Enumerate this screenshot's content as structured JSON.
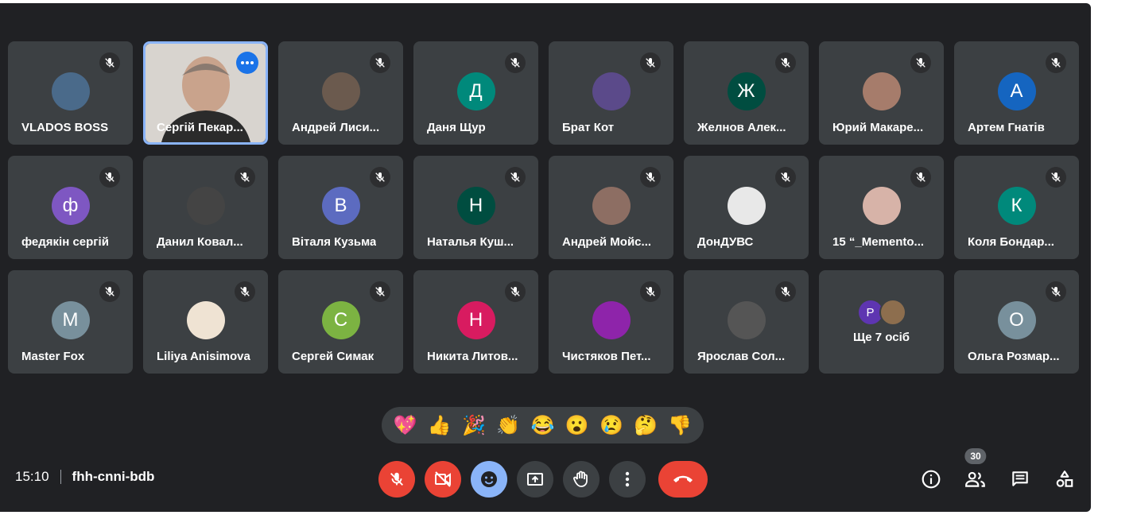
{
  "meeting": {
    "time": "15:10",
    "code": "fhh-cnni-bdb",
    "participant_count": "30"
  },
  "participants": [
    {
      "name": "VLADOS BOSS",
      "avatar_color": "#4a6a8a",
      "avatar_letter": ""
    },
    {
      "name": "Сергій Пекар...",
      "video": true
    },
    {
      "name": "Андрей Лиси...",
      "avatar_color": "#6b5a4e",
      "avatar_letter": ""
    },
    {
      "name": "Даня Щур",
      "avatar_color": "#00897b",
      "avatar_letter": "Д"
    },
    {
      "name": "Брат Кот",
      "avatar_color": "#5b4a8a",
      "avatar_letter": ""
    },
    {
      "name": "Желнов Алек...",
      "avatar_color": "#004d40",
      "avatar_letter": "Ж"
    },
    {
      "name": "Юрий Макаре...",
      "avatar_color": "#a67c6b",
      "avatar_letter": ""
    },
    {
      "name": "Артем Гнатів",
      "avatar_color": "#1565c0",
      "avatar_letter": "А"
    },
    {
      "name": "федякін сергій",
      "avatar_color": "#7e57c2",
      "avatar_letter": "ф"
    },
    {
      "name": "Данил Ковал...",
      "avatar_color": "#444444",
      "avatar_letter": ""
    },
    {
      "name": "Віталя Кузьма",
      "avatar_color": "#5c6bc0",
      "avatar_letter": "В"
    },
    {
      "name": "Наталья Куш...",
      "avatar_color": "#004d40",
      "avatar_letter": "Н"
    },
    {
      "name": "Андрей Мойс...",
      "avatar_color": "#8d6e63",
      "avatar_letter": ""
    },
    {
      "name": "ДонДУВС",
      "avatar_color": "#e8e8e8",
      "avatar_letter": ""
    },
    {
      "name": "15 “_Memento...",
      "avatar_color": "#d7b3a8",
      "avatar_letter": ""
    },
    {
      "name": "Коля Бондар...",
      "avatar_color": "#00897b",
      "avatar_letter": "К"
    },
    {
      "name": "Master Fox",
      "avatar_color": "#78909c",
      "avatar_letter": "M"
    },
    {
      "name": "Liliya Anisimova",
      "avatar_color": "#efe3d3",
      "avatar_letter": ""
    },
    {
      "name": "Сергей Симак",
      "avatar_color": "#7cb342",
      "avatar_letter": "С"
    },
    {
      "name": "Никита Литов...",
      "avatar_color": "#d81b60",
      "avatar_letter": "Н"
    },
    {
      "name": "Чистяков Пет...",
      "avatar_color": "#8e24aa",
      "avatar_letter": ""
    },
    {
      "name": "Ярослав Сол...",
      "avatar_color": "#555555",
      "avatar_letter": ""
    },
    {
      "more": true,
      "label": "Ще 7 осіб",
      "letter": "P",
      "color": "#5e35b1",
      "color2": "#8d6e4e"
    },
    {
      "name": "Ольга Розмар...",
      "avatar_color": "#78909c",
      "avatar_letter": "О"
    }
  ],
  "reactions": [
    "💖",
    "👍",
    "🎉",
    "👏",
    "😂",
    "😮",
    "😢",
    "🤔",
    "👎"
  ],
  "controls": [
    {
      "name": "mic-off-button",
      "icon": "mic-off-icon",
      "color": "red"
    },
    {
      "name": "camera-off-button",
      "icon": "camera-off-icon",
      "color": "red"
    },
    {
      "name": "reactions-button",
      "icon": "emoji-icon",
      "color": "blue"
    },
    {
      "name": "present-button",
      "icon": "present-icon",
      "color": "grey"
    },
    {
      "name": "raise-hand-button",
      "icon": "hand-icon",
      "color": "grey"
    },
    {
      "name": "more-options-button",
      "icon": "more-vert-icon",
      "color": "grey"
    },
    {
      "name": "leave-call-button",
      "icon": "call-end-icon",
      "color": "end"
    }
  ]
}
